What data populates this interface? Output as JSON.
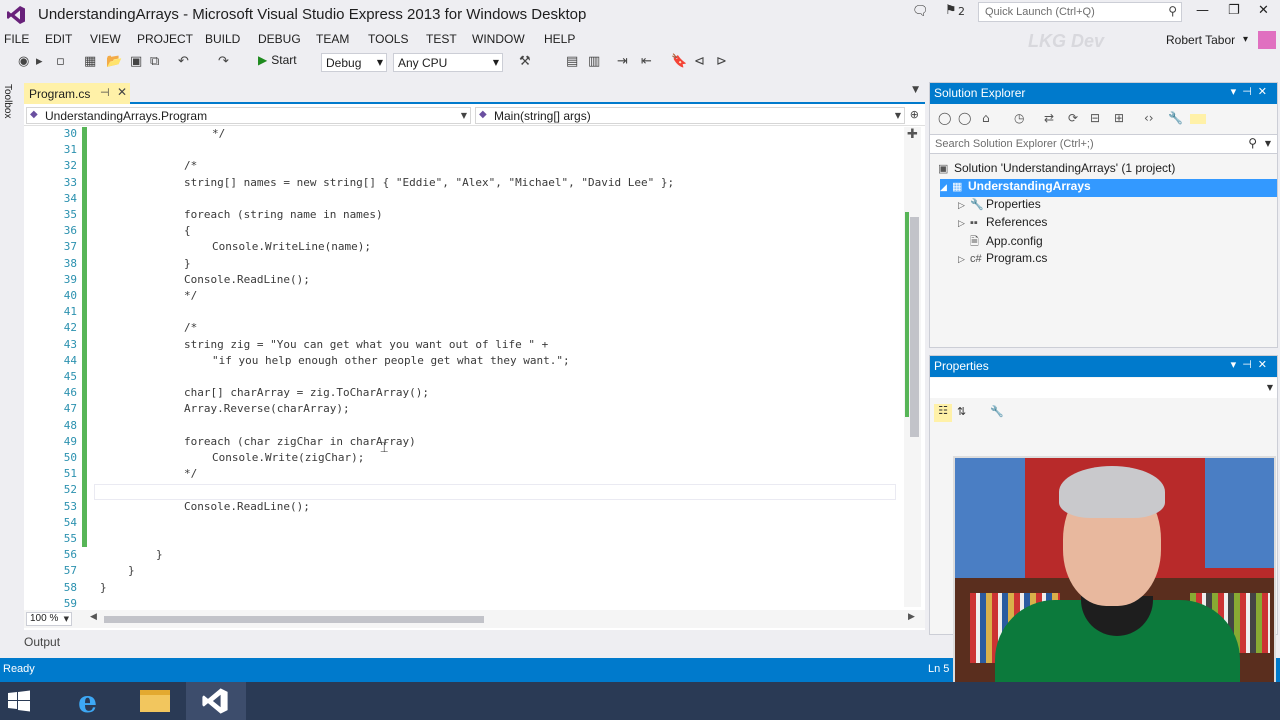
{
  "window": {
    "title": "UnderstandingArrays - Microsoft Visual Studio Express 2013 for Windows Desktop",
    "feedback_count": "2",
    "quick_launch_placeholder": "Quick Launch (Ctrl+Q)",
    "user": "Robert Tabor",
    "watermark": "LKG Dev"
  },
  "menu": [
    "FILE",
    "EDIT",
    "VIEW",
    "PROJECT",
    "BUILD",
    "DEBUG",
    "TEAM",
    "TOOLS",
    "TEST",
    "WINDOW",
    "HELP"
  ],
  "toolbar": {
    "start_label": "Start",
    "configuration": "Debug",
    "platform": "Any CPU"
  },
  "toolbox_label": "Toolbox",
  "editor": {
    "tab_label": "Program.cs",
    "nav_class": "UnderstandingArrays.Program",
    "nav_member": "Main(string[] args)",
    "zoom": "100 %",
    "line_numbers": [
      "30",
      "31",
      "32",
      "33",
      "34",
      "35",
      "36",
      "37",
      "38",
      "39",
      "40",
      "41",
      "42",
      "43",
      "44",
      "45",
      "46",
      "47",
      "48",
      "49",
      "50",
      "51",
      "52",
      "53",
      "54",
      "55",
      "56",
      "57",
      "58",
      "59"
    ],
    "lines": [
      {
        "indent": 1,
        "text": "*/"
      },
      {
        "indent": 0,
        "text": ""
      },
      {
        "indent": 0,
        "text": "/*"
      },
      {
        "indent": 0,
        "text": "string[] names = new string[] { \"Eddie\", \"Alex\", \"Michael\", \"David Lee\" };"
      },
      {
        "indent": 0,
        "text": ""
      },
      {
        "indent": 0,
        "text": "foreach (string name in names)"
      },
      {
        "indent": 0,
        "text": "{"
      },
      {
        "indent": 1,
        "text": "Console.WriteLine(name);"
      },
      {
        "indent": 0,
        "text": "}"
      },
      {
        "indent": 0,
        "text": "Console.ReadLine();"
      },
      {
        "indent": 0,
        "text": "*/"
      },
      {
        "indent": 0,
        "text": ""
      },
      {
        "indent": 0,
        "text": "/*"
      },
      {
        "indent": 0,
        "text": "string zig = \"You can get what you want out of life \" +"
      },
      {
        "indent": 1,
        "text": "\"if you help enough other people get what they want.\";"
      },
      {
        "indent": 0,
        "text": ""
      },
      {
        "indent": 0,
        "text": "char[] charArray = zig.ToCharArray();"
      },
      {
        "indent": 0,
        "text": "Array.Reverse(charArray);"
      },
      {
        "indent": 0,
        "text": ""
      },
      {
        "indent": 0,
        "text": "foreach (char zigChar in charArray)"
      },
      {
        "indent": 1,
        "text": "Console.Write(zigChar);"
      },
      {
        "indent": 0,
        "text": "*/"
      },
      {
        "indent": 0,
        "text": ""
      },
      {
        "indent": 0,
        "text": "Console.ReadLine();"
      },
      {
        "indent": 0,
        "text": ""
      },
      {
        "indent": 0,
        "text": ""
      },
      {
        "indent": -1,
        "text": "}"
      },
      {
        "indent": -2,
        "text": "}"
      },
      {
        "indent": -3,
        "text": "}"
      },
      {
        "indent": 0,
        "text": ""
      }
    ]
  },
  "output_tab": "Output",
  "status": {
    "text": "Ready",
    "position": "Ln 5"
  },
  "solution_explorer": {
    "title": "Solution Explorer",
    "search_placeholder": "Search Solution Explorer (Ctrl+;)",
    "solution": "Solution 'UnderstandingArrays' (1 project)",
    "project": "UnderstandingArrays",
    "items": [
      "Properties",
      "References",
      "App.config",
      "Program.cs"
    ]
  },
  "properties": {
    "title": "Properties"
  },
  "colors": {
    "accent": "#007acc",
    "active_tab": "#fff1a8",
    "change_bar": "#57b557",
    "line_number": "#2b91af"
  }
}
